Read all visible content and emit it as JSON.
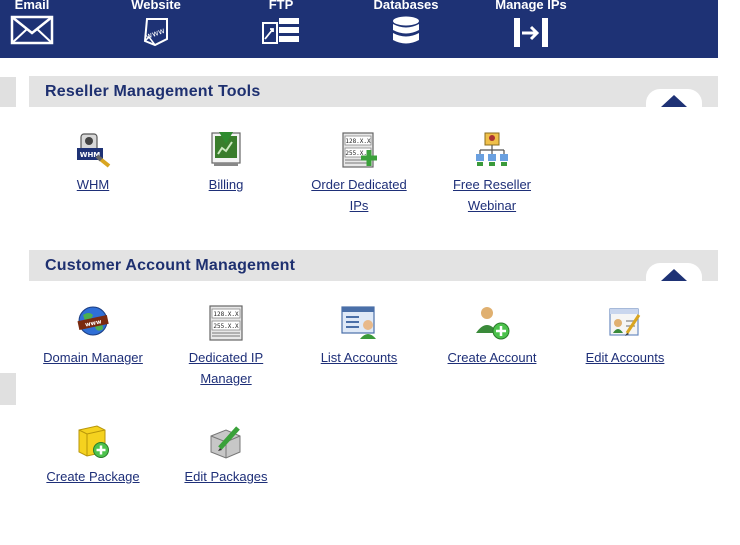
{
  "top_nav": [
    {
      "label": "Email",
      "icon": "envelope-icon"
    },
    {
      "label": "Website",
      "icon": "website-icon"
    },
    {
      "label": "FTP",
      "icon": "ftp-icon"
    },
    {
      "label": "Databases",
      "icon": "database-icon"
    },
    {
      "label": "Manage IPs",
      "icon": "manage-ips-icon"
    }
  ],
  "reseller_tools": {
    "title": "Reseller Management Tools",
    "items": [
      {
        "label": "WHM",
        "icon": "whm-icon"
      },
      {
        "label": "Billing",
        "icon": "billing-icon"
      },
      {
        "label": "Order Dedicated IPs",
        "icon": "ip-address-icon"
      },
      {
        "label": "Free Reseller Webinar",
        "icon": "webinar-icon"
      }
    ]
  },
  "customer_accounts": {
    "title": "Customer Account Management",
    "items": [
      {
        "label": "Domain Manager",
        "icon": "globe-icon"
      },
      {
        "label": "Dedicated IP Manager",
        "icon": "ip-address-icon"
      },
      {
        "label": "List Accounts",
        "icon": "list-accounts-icon"
      },
      {
        "label": "Create Account",
        "icon": "add-user-icon"
      },
      {
        "label": "Edit Accounts",
        "icon": "edit-accounts-icon"
      },
      {
        "label": "Create Package",
        "icon": "add-package-icon"
      },
      {
        "label": "Edit Packages",
        "icon": "edit-packages-icon"
      }
    ]
  },
  "colors": {
    "nav_bg": "#1e3275",
    "link": "#1e2f78",
    "section_bg": "#e3e3e3"
  }
}
